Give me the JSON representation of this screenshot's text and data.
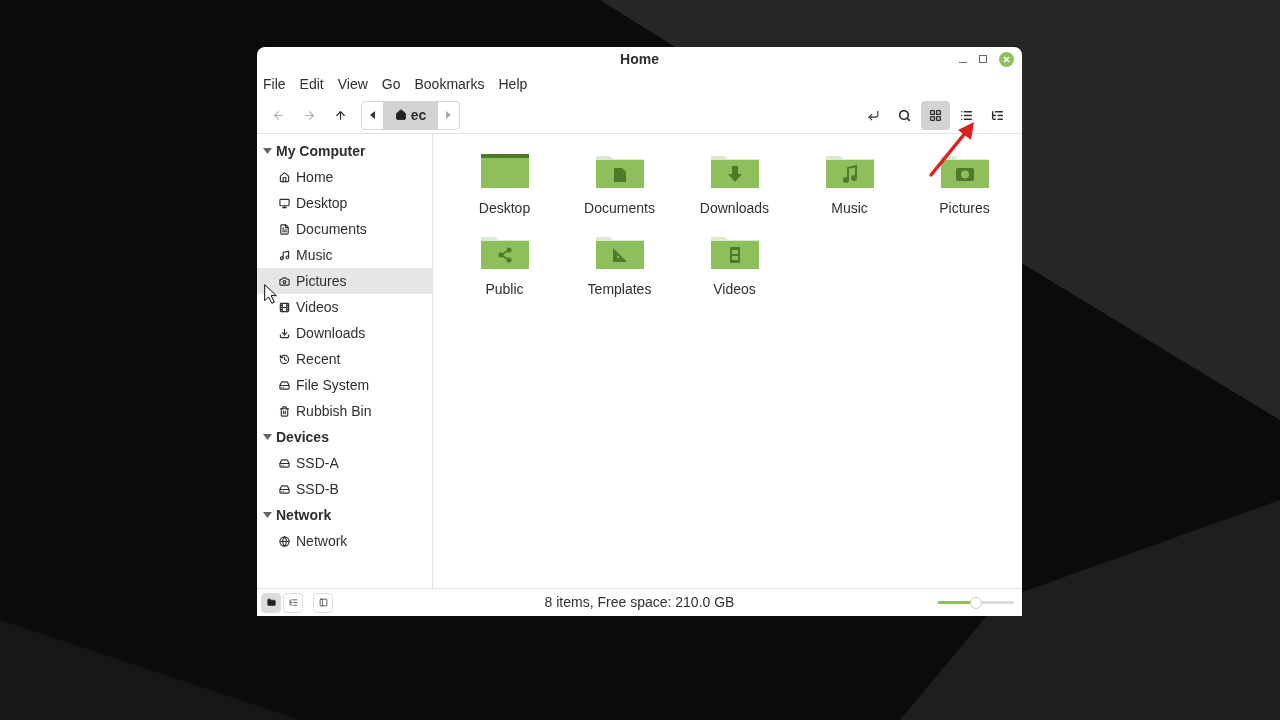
{
  "window": {
    "title": "Home"
  },
  "menu": [
    "File",
    "Edit",
    "View",
    "Go",
    "Bookmarks",
    "Help"
  ],
  "toolbar": {
    "back_disabled": true,
    "forward_disabled": true,
    "breadcrumb": "ec",
    "views": [
      {
        "selected": true
      },
      {
        "selected": false
      },
      {
        "selected": false
      }
    ]
  },
  "sidebar": [
    {
      "title": "My Computer",
      "expanded": true,
      "items": [
        {
          "label": "Home",
          "selected": false
        },
        {
          "label": "Desktop",
          "selected": false
        },
        {
          "label": "Documents",
          "selected": false
        },
        {
          "label": "Music",
          "selected": false
        },
        {
          "label": "Pictures",
          "selected": true
        },
        {
          "label": "Videos",
          "selected": false
        },
        {
          "label": "Downloads",
          "selected": false
        },
        {
          "label": "Recent",
          "selected": false
        },
        {
          "label": "File System",
          "selected": false
        },
        {
          "label": "Rubbish Bin",
          "selected": false
        }
      ]
    },
    {
      "title": "Devices",
      "expanded": true,
      "items": [
        {
          "label": "SSD-A",
          "selected": false
        },
        {
          "label": "SSD-B",
          "selected": false
        }
      ]
    },
    {
      "title": "Network",
      "expanded": true,
      "items": [
        {
          "label": "Network",
          "selected": false
        }
      ]
    }
  ],
  "files": [
    {
      "name": "Desktop",
      "kind": "desktop"
    },
    {
      "name": "Documents",
      "kind": "document"
    },
    {
      "name": "Downloads",
      "kind": "download"
    },
    {
      "name": "Music",
      "kind": "music"
    },
    {
      "name": "Pictures",
      "kind": "camera"
    },
    {
      "name": "Public",
      "kind": "share"
    },
    {
      "name": "Templates",
      "kind": "template"
    },
    {
      "name": "Videos",
      "kind": "video"
    }
  ],
  "status_bar": {
    "text": "8 items, Free space: 210.0 GB",
    "zoom": {
      "level": 0.5
    },
    "panes": [
      {
        "selected": true
      },
      {
        "selected": false
      }
    ]
  }
}
